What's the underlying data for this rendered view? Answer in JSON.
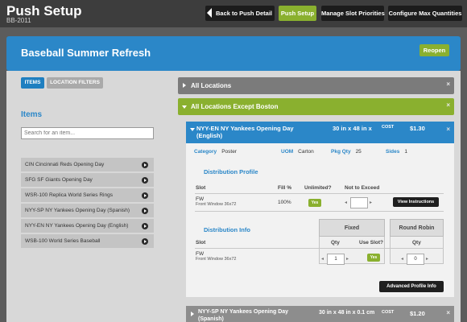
{
  "app": {
    "title": "Push Setup",
    "subtitle": "BB-2011"
  },
  "topnav": {
    "back": "Back to Push Detail",
    "push_setup": "Push Setup",
    "slot_priorities": "Manage Slot Priorities",
    "max_quantities": "Configure Max Quantities"
  },
  "banner": {
    "title": "Baseball Summer Refresh",
    "reopen": "Reopen"
  },
  "left": {
    "tabs": {
      "items": "ITEMS",
      "location_filters": "LOCATION FILTERS"
    },
    "heading": "Items",
    "search_placeholder": "Search for an item...",
    "items": [
      "CIN Cincinnati Reds Opening Day",
      "SFG SF Giants Opening Day",
      "WSR-100 Replica World Series Rings",
      "NYY-SP NY Yankees Opening Day (Spanish)",
      "NYY-EN NY Yankees Opening Day (English)",
      "WSB-100 World Series Baseball"
    ]
  },
  "right": {
    "all_locations": "All Locations",
    "except_boston": "All Locations Except Boston",
    "close": "×",
    "card": {
      "name": "NYY-EN NY Yankees Opening Day",
      "name_sub": "(English)",
      "dims": "30 in x 48 in x",
      "cost_label": "COST",
      "cost": "$1.30",
      "category_label": "Category",
      "category": "Poster",
      "uom_label": "UOM",
      "uom": "Carton",
      "pkg_label": "Pkg Qty",
      "pkg": "25",
      "sides_label": "Sides",
      "sides": "1",
      "dist_profile": {
        "title": "Distribution Profile",
        "headers": [
          "Slot",
          "Fill %",
          "Unlimited?",
          "Not to Exceed"
        ],
        "slot": "FW",
        "slot_sub": "Front Window 36x72",
        "fill": "100%",
        "unlimited": "Yes",
        "view_instructions": "View Instructions"
      },
      "dist_info": {
        "title": "Distribution Info",
        "fixed": "Fixed",
        "round_robin": "Round Robin",
        "headers": [
          "Slot",
          "Qty",
          "Use Slot?",
          "Qty"
        ],
        "slot": "FW",
        "slot_sub": "Front Window 36x72",
        "qty": "1",
        "use_slot": "Yes",
        "rr_qty": "0"
      },
      "advanced": "Advanced Profile Info"
    },
    "next": {
      "name": "NYY-SP NY Yankees Opening Day",
      "name_sub": "(Spanish)",
      "dims": "30 in x 48 in x 0.1 cm",
      "cost_label": "COST",
      "cost": "$1.20"
    }
  }
}
